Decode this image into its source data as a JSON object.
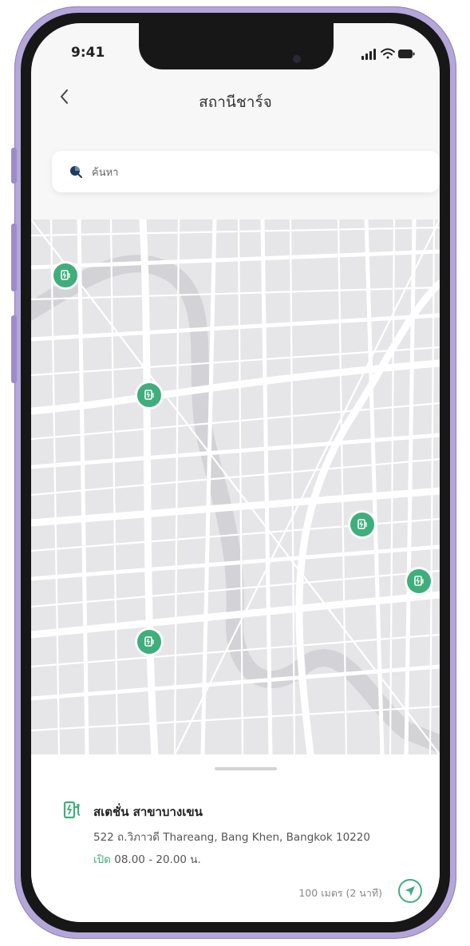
{
  "status_bar": {
    "time": "9:41"
  },
  "header": {
    "back_icon": "chevron-left-icon",
    "title": "สถานีชาร์จ"
  },
  "search": {
    "placeholder": "ค้นหา",
    "icon": "search-icon"
  },
  "map": {
    "pin_icon": "charging-station-icon",
    "pin_color": "#3fae7c"
  },
  "station": {
    "icon": "ev-charger-icon",
    "name": "สเตชั่น สาขาบางเขน",
    "address": "522 ถ.วิภาวดี Thareang, Bang Khen, Bangkok 10220",
    "open_label": "เปิด",
    "hours": "08.00 - 20.00 น.",
    "distance": "100 เมตร (2 นาที)",
    "nav_icon": "navigation-arrow-icon"
  },
  "colors": {
    "accent": "#3fae7c",
    "frame": "#b5a6da",
    "map_bg": "#e6e6e9"
  }
}
